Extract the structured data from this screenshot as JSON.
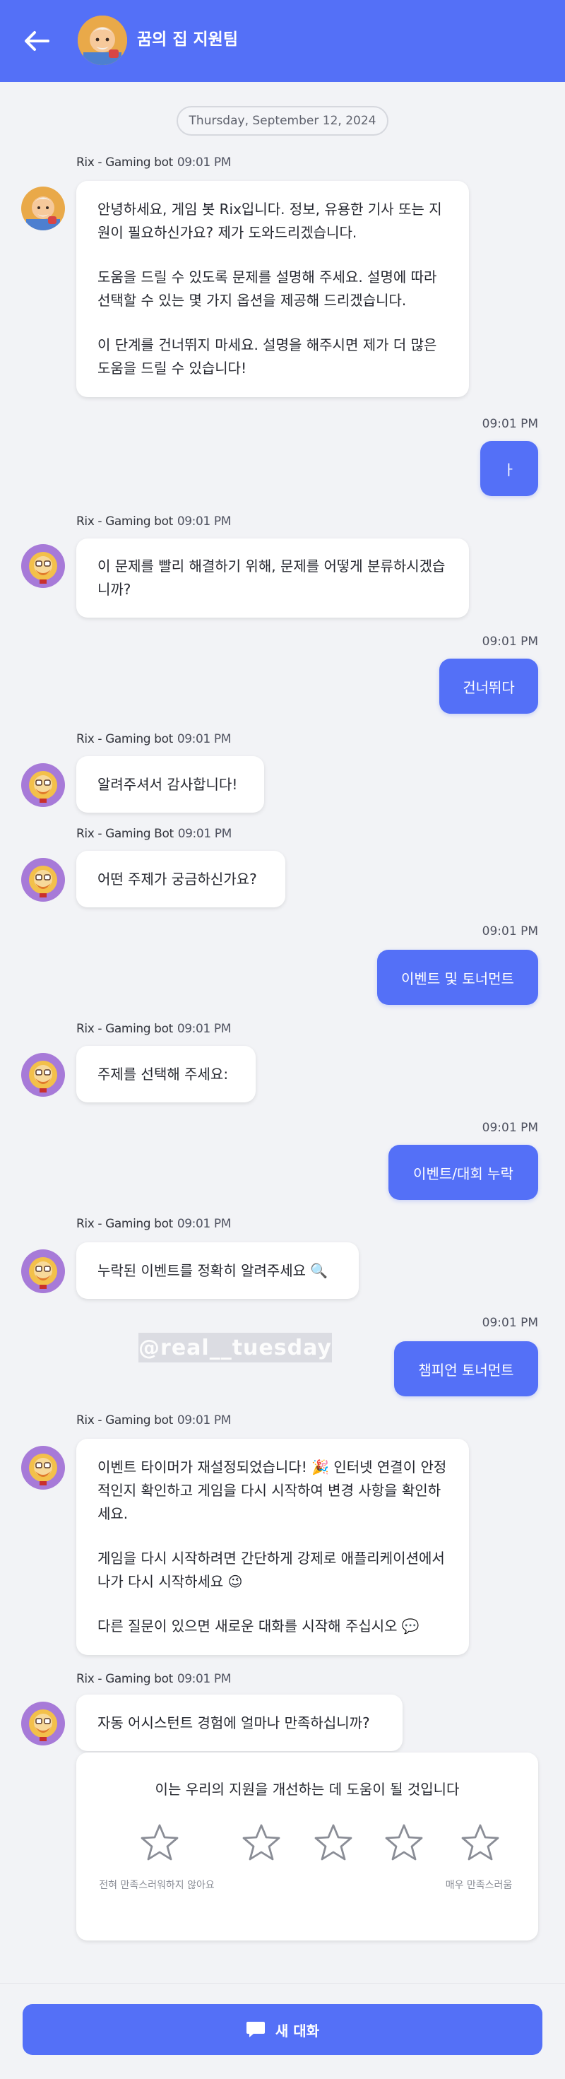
{
  "header": {
    "title": "꿈의 집 지원팀",
    "back_icon": "arrow-left-icon"
  },
  "date_divider": "Thursday, September 12, 2024",
  "messages": {
    "m1": {
      "sender": "Rix - Gaming bot",
      "time": "09:01 PM",
      "p1": "안녕하세요, 게임 봇 Rix입니다. 정보, 유용한 기사 또는 지원이 필요하신가요? 제가 도와드리겠습니다.",
      "p2": "도움을 드릴 수 있도록 문제를 설명해 주세요. 설명에 따라 선택할 수 있는 몇 가지 옵션을 제공해 드리겠습니다.",
      "p3": "이 단계를 건너뛰지 마세요. 설명을 해주시면 제가 더 많은 도움을 드릴 수 있습니다!"
    },
    "u1": {
      "time": "09:01 PM",
      "text": "ㅏ"
    },
    "m2": {
      "sender": "Rix - Gaming bot",
      "time": "09:01 PM",
      "text": "이 문제를 빨리 해결하기 위해, 문제를 어떻게 분류하시겠습니까?"
    },
    "u2": {
      "time": "09:01 PM",
      "text": "건너뛰다"
    },
    "m3": {
      "sender": "Rix - Gaming bot",
      "time": "09:01 PM",
      "text": "알려주셔서 감사합니다!"
    },
    "m4": {
      "sender": "Rix - Gaming Bot",
      "time": "09:01 PM",
      "text": "어떤 주제가 궁금하신가요?"
    },
    "u3": {
      "time": "09:01 PM",
      "text": "이벤트 및 토너먼트"
    },
    "m5": {
      "sender": "Rix - Gaming bot",
      "time": "09:01 PM",
      "text": "주제를 선택해 주세요:"
    },
    "u4": {
      "time": "09:01 PM",
      "text": "이벤트/대회 누락"
    },
    "m6": {
      "sender": "Rix - Gaming bot",
      "time": "09:01 PM",
      "text": "누락된 이벤트를 정확히 알려주세요 🔍"
    },
    "u5": {
      "time": "09:01 PM",
      "text": "챔피언 토너먼트"
    },
    "m7": {
      "sender": "Rix - Gaming bot",
      "time": "09:01 PM",
      "p1": "이벤트 타이머가 재설정되었습니다! 🎉 인터넷 연결이 안정적인지 확인하고 게임을 다시 시작하여 변경 사항을 확인하세요.",
      "p2": "게임을 다시 시작하려면 간단하게 강제로 애플리케이션에서 나가 다시 시작하세요 😉",
      "p3": "다른 질문이 있으면 새로운 대화를 시작해 주십시오 💬"
    },
    "m8": {
      "sender": "Rix - Gaming bot",
      "time": "09:01 PM",
      "text": "자동 어시스턴트 경험에 얼마나 만족하십니까?"
    }
  },
  "watermark": "@real__tuesday",
  "rating": {
    "title": "이는 우리의 지원을 개선하는 데 도움이 될 것입니다",
    "stars": 5,
    "selected": 0,
    "low_label": "전혀 만족스러워하지 않아요",
    "high_label": "매우 만족스러움",
    "star_icon": "star-outline-icon"
  },
  "footer": {
    "new_chat_label": "새 대화",
    "icon": "chat-bubble-icon"
  },
  "colors": {
    "accent": "#5470f7",
    "background": "#f2f3f6",
    "bubble": "#ffffff"
  }
}
